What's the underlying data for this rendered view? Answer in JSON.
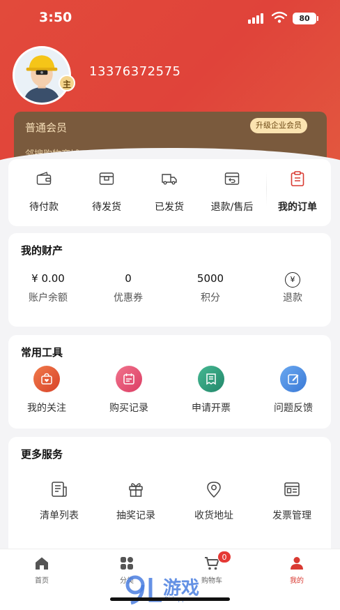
{
  "status_bar": {
    "time": "3:50",
    "battery": "80"
  },
  "profile": {
    "phone": "13376372575",
    "role_badge": "主"
  },
  "member": {
    "level": "普通会员",
    "upgrade_label": "升级企业会员",
    "subtitle": "邻搜购物商城"
  },
  "orders": [
    {
      "label": "待付款",
      "icon": "wallet-icon"
    },
    {
      "label": "待发货",
      "icon": "package-icon"
    },
    {
      "label": "已发货",
      "icon": "truck-icon"
    },
    {
      "label": "退款/售后",
      "icon": "return-icon"
    },
    {
      "label": "我的订单",
      "icon": "clipboard-icon"
    }
  ],
  "assets": {
    "title": "我的财产",
    "items": [
      {
        "value": "¥ 0.00",
        "label": "账户余额"
      },
      {
        "value": "0",
        "label": "优惠券"
      },
      {
        "value": "5000",
        "label": "积分"
      },
      {
        "value": "¥",
        "label": "退款",
        "icon": "yen-circle-icon"
      }
    ]
  },
  "tools": {
    "title": "常用工具",
    "items": [
      {
        "label": "我的关注",
        "icon": "heart-bag-icon",
        "color": "#e4572e"
      },
      {
        "label": "购买记录",
        "icon": "calendar-icon",
        "color": "#e84b6b"
      },
      {
        "label": "申请开票",
        "icon": "receipt-icon",
        "color": "#2e9e7e"
      },
      {
        "label": "问题反馈",
        "icon": "edit-icon",
        "color": "#4a8fe0"
      }
    ]
  },
  "services": {
    "title": "更多服务",
    "items": [
      {
        "label": "清单列表",
        "icon": "list-icon"
      },
      {
        "label": "抽奖记录",
        "icon": "gift-icon"
      },
      {
        "label": "收货地址",
        "icon": "location-icon"
      },
      {
        "label": "发票管理",
        "icon": "invoice-icon"
      }
    ]
  },
  "tabbar": [
    {
      "label": "首页",
      "icon": "home-icon"
    },
    {
      "label": "分类",
      "icon": "category-icon"
    },
    {
      "label": "购物车",
      "icon": "cart-icon",
      "badge": "0"
    },
    {
      "label": "我的",
      "icon": "user-icon",
      "active": true
    }
  ],
  "watermark": {
    "text": "游戏",
    "sub": "9idapp.com"
  }
}
